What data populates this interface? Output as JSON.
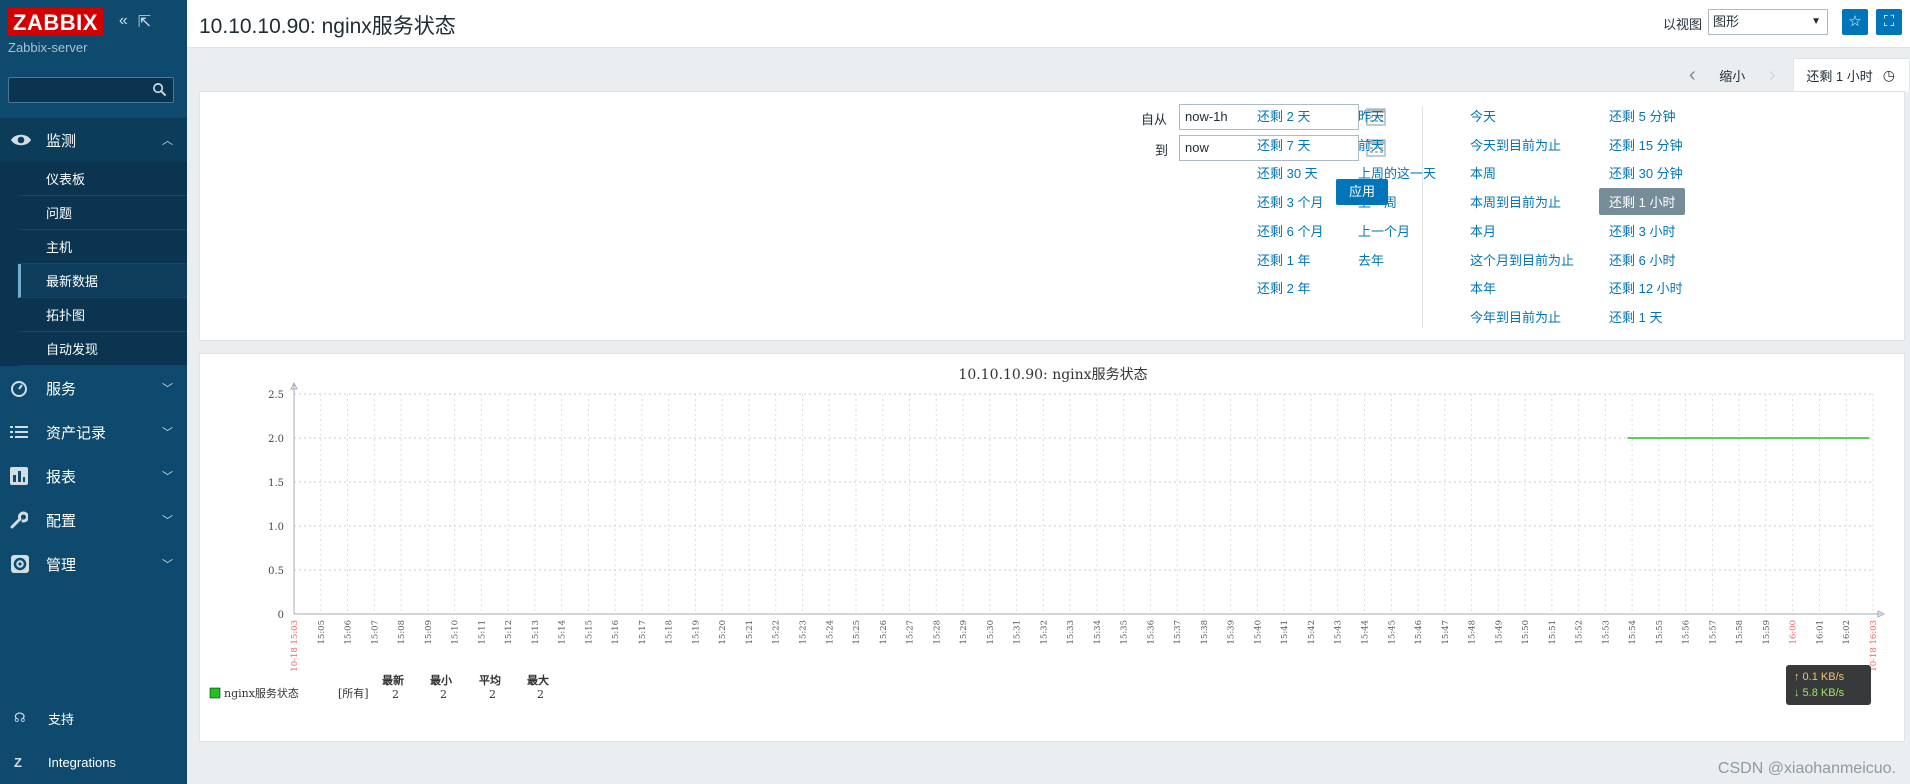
{
  "sidebar": {
    "logo": "ZABBIX",
    "server_name": "Zabbix-server",
    "search_placeholder": "",
    "menu": [
      {
        "label": "监测",
        "icon": "eye-icon",
        "expanded": true
      },
      {
        "label": "服务",
        "icon": "clock-icon"
      },
      {
        "label": "资产记录",
        "icon": "list-icon"
      },
      {
        "label": "报表",
        "icon": "bar-chart-icon"
      },
      {
        "label": "配置",
        "icon": "wrench-icon"
      },
      {
        "label": "管理",
        "icon": "gear-icon"
      }
    ],
    "submenu": [
      "仪表板",
      "问题",
      "主机",
      "最新数据",
      "拓扑图",
      "自动发现"
    ],
    "selected_submenu": "最新数据",
    "bottom": [
      {
        "label": "支持",
        "icon": "headset-icon"
      },
      {
        "label": "Integrations",
        "icon": "z-icon"
      }
    ]
  },
  "header": {
    "title": "10.10.10.90: nginx服务状态",
    "view_label": "以视图",
    "view_value": "图形"
  },
  "time_tabs": {
    "zoom_out": "缩小",
    "active": "还剩 1 小时"
  },
  "filter": {
    "from_label": "自从",
    "from_value": "now-1h",
    "to_label": "到",
    "to_value": "now",
    "apply": "应用",
    "quick": [
      [
        "还剩 2 天",
        "还剩 7 天",
        "还剩 30 天",
        "还剩 3 个月",
        "还剩 6 个月",
        "还剩 1 年",
        "还剩 2 年"
      ],
      [
        "昨天",
        "前天",
        "上周的这一天",
        "上一周",
        "上一个月",
        "去年"
      ],
      [
        "今天",
        "今天到目前为止",
        "本周",
        "本周到目前为止",
        "本月",
        "这个月到目前为止",
        "本年",
        "今年到目前为止"
      ],
      [
        "还剩 5 分钟",
        "还剩 15 分钟",
        "还剩 30 分钟",
        "还剩 1 小时",
        "还剩 3 小时",
        "还剩 6 小时",
        "还剩 12 小时",
        "还剩 1 天"
      ]
    ],
    "selected_quick": "还剩 1 小时"
  },
  "chart_data": {
    "type": "line",
    "title": "10.10.10.90: nginx服务状态",
    "ylim": [
      0,
      2.5
    ],
    "yticks": [
      "0",
      "0.5",
      "1.0",
      "1.5",
      "2.0",
      "2.5"
    ],
    "xticks": [
      "10-18 15:03",
      "15:05",
      "15:06",
      "15:07",
      "15:08",
      "15:09",
      "15:10",
      "15:11",
      "15:12",
      "15:13",
      "15:14",
      "15:15",
      "15:16",
      "15:17",
      "15:18",
      "15:19",
      "15:20",
      "15:21",
      "15:22",
      "15:23",
      "15:24",
      "15:25",
      "15:26",
      "15:27",
      "15:28",
      "15:29",
      "15:30",
      "15:31",
      "15:32",
      "15:33",
      "15:34",
      "15:35",
      "15:36",
      "15:37",
      "15:38",
      "15:39",
      "15:40",
      "15:41",
      "15:42",
      "15:43",
      "15:44",
      "15:45",
      "15:46",
      "15:47",
      "15:48",
      "15:49",
      "15:50",
      "15:51",
      "15:52",
      "15:53",
      "15:54",
      "15:55",
      "15:56",
      "15:57",
      "15:58",
      "15:59",
      "16:00",
      "16:01",
      "16:02",
      "10-18 16:03"
    ],
    "red_ticks": [
      "10-18 15:03",
      "16:00",
      "10-18 16:03"
    ],
    "series": [
      {
        "name": "nginx服务状态",
        "color": "#1fc31f",
        "x_start": "15:53:40",
        "x_end": "16:03",
        "value": 2
      }
    ],
    "legend": {
      "headers": [
        "最新",
        "最小",
        "平均",
        "最大"
      ],
      "scope": "[所有]",
      "values": [
        "2",
        "2",
        "2",
        "2"
      ]
    }
  },
  "tooltip": {
    "upload": "↑ 0.1 KB/s",
    "download": "↓ 5.8 KB/s"
  },
  "watermark": "CSDN @xiaohanmeicuo."
}
